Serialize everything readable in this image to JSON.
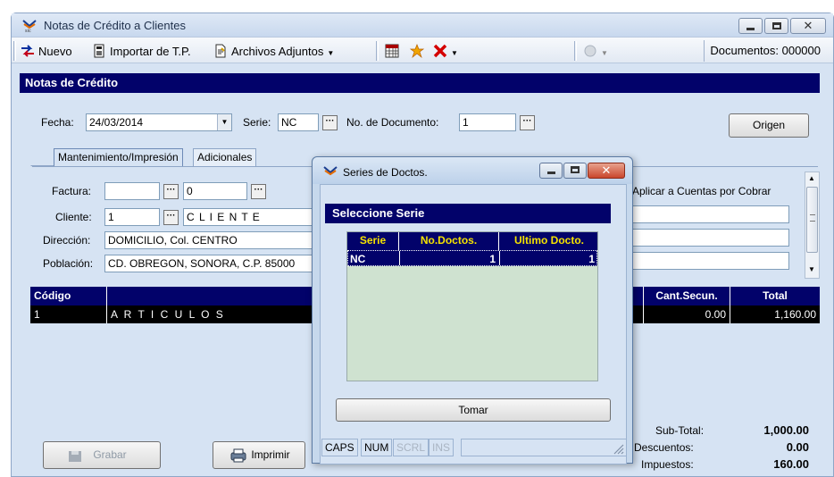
{
  "window": {
    "title": "Notas de Crédito a Clientes"
  },
  "toolbar": {
    "nuevo": "Nuevo",
    "importar": "Importar de T.P.",
    "archivos": "Archivos Adjuntos",
    "documentos": "Documentos: 000000"
  },
  "section": {
    "title": "Notas de Crédito"
  },
  "header_fields": {
    "fecha_label": "Fecha:",
    "fecha_value": "24/03/2014",
    "serie_label": "Serie:",
    "serie_value": "NC",
    "nodoc_label": "No. de Documento:",
    "nodoc_value": "1",
    "origen_button": "Origen"
  },
  "tabs": [
    {
      "label": "Mantenimiento/Impresión"
    },
    {
      "label": "Adicionales"
    }
  ],
  "form": {
    "factura_label": "Factura:",
    "factura_value1": "",
    "factura_value2": "0",
    "cliente_label": "Cliente:",
    "cliente_code": "1",
    "cliente_name": "C L I E N T E",
    "direccion_label": "Dirección:",
    "direccion_value": "DOMICILIO, Col. CENTRO",
    "poblacion_label": "Población:",
    "poblacion_value": "CD. OBREGON, SONORA, C.P. 85000",
    "aplicar_label": "Aplicar a Cuentas por Cobrar"
  },
  "grid": {
    "headers": {
      "codigo": "Código",
      "cant_secun": "Cant.Secun.",
      "total": "Total"
    },
    "rows": [
      {
        "codigo": "1",
        "descripcion": "A R T I C U L O S",
        "cant_secun": "0.00",
        "total": "1,160.00"
      }
    ]
  },
  "totals": {
    "subtotal_label": "Sub-Total:",
    "subtotal_value": "1,000.00",
    "descuentos_label": "Descuentos:",
    "descuentos_value": "0.00",
    "impuestos_label": "Impuestos:",
    "impuestos_value": "160.00"
  },
  "buttons": {
    "grabar": "Grabar",
    "imprimir": "Imprimir"
  },
  "dialog": {
    "title": "Series de Doctos.",
    "header": "Seleccione Serie",
    "columns": {
      "serie": "Serie",
      "nodoctos": "No.Doctos.",
      "ultimo": "Ultimo Docto."
    },
    "rows": [
      {
        "serie": "NC",
        "nodoctos": "1",
        "ultimo": "1"
      }
    ],
    "tomar_button": "Tomar",
    "status": {
      "caps": "CAPS",
      "num": "NUM",
      "scrl": "SCRL",
      "ins": "INS"
    }
  },
  "colors": {
    "navy": "#02026a",
    "window_bg": "#d6e3f3",
    "dialog_header_text": "#f5e200"
  }
}
